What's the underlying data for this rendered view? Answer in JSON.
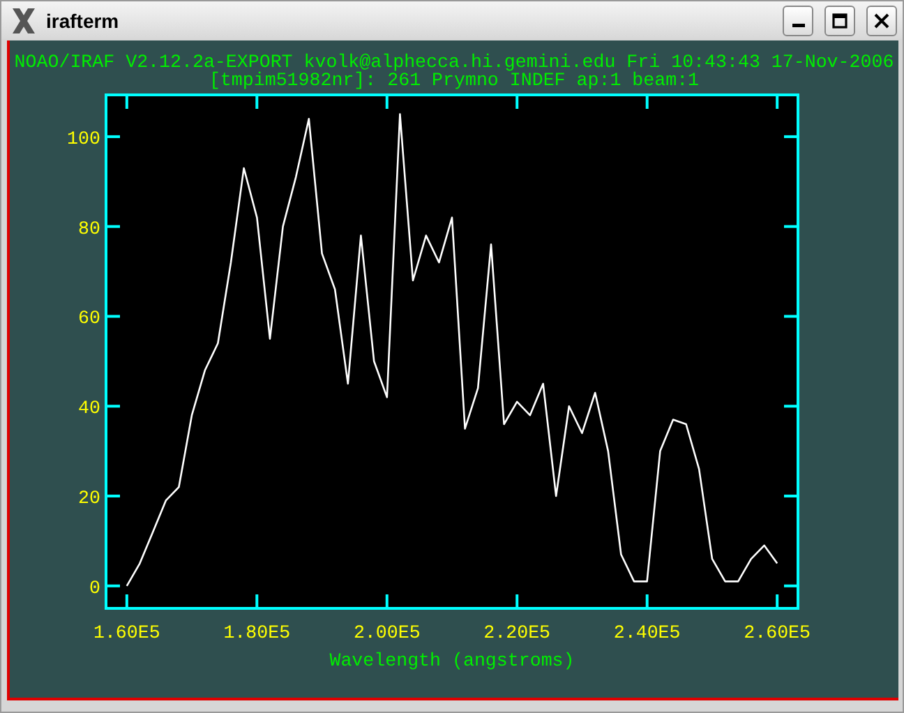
{
  "window": {
    "title": "irafterm"
  },
  "header": "NOAO/IRAF V2.12.2a-EXPORT kvolk@alphecca.hi.gemini.edu Fri 10:43:43 17-Nov-2006",
  "chart_data": {
    "type": "line",
    "title": "[tmpim51982nr]: 261 Prymno INDEF ap:1 beam:1",
    "xlabel": "Wavelength (angstroms)",
    "x": [
      160000,
      162000,
      164000,
      166000,
      168000,
      170000,
      172000,
      174000,
      176000,
      178000,
      180000,
      182000,
      184000,
      186000,
      188000,
      190000,
      192000,
      194000,
      196000,
      198000,
      200000,
      202000,
      204000,
      206000,
      208000,
      210000,
      212000,
      214000,
      216000,
      218000,
      220000,
      222000,
      224000,
      226000,
      228000,
      230000,
      232000,
      234000,
      236000,
      238000,
      240000,
      242000,
      244000,
      246000,
      248000,
      250000,
      252000,
      254000,
      256000,
      258000,
      260000
    ],
    "series": [
      {
        "color": "#ffffff",
        "values": [
          0,
          5,
          12,
          19,
          22,
          38,
          48,
          54,
          72,
          93,
          82,
          55,
          80,
          91,
          104,
          74,
          66,
          45,
          78,
          50,
          42,
          105,
          68,
          78,
          72,
          82,
          35,
          44,
          76,
          36,
          41,
          38,
          45,
          20,
          40,
          34,
          43,
          30,
          7,
          1,
          1,
          30,
          37,
          36,
          26,
          6,
          1,
          1,
          6,
          9,
          5
        ]
      }
    ],
    "xlim": [
      156800,
      263200
    ],
    "ylim": [
      -5,
      109.3
    ],
    "xticks": [
      {
        "value": 160000,
        "label": "1.60E5"
      },
      {
        "value": 180000,
        "label": "1.80E5"
      },
      {
        "value": 200000,
        "label": "2.00E5"
      },
      {
        "value": 220000,
        "label": "2.20E5"
      },
      {
        "value": 240000,
        "label": "2.40E5"
      },
      {
        "value": 260000,
        "label": "2.60E5"
      }
    ],
    "yticks": [
      0,
      20,
      40,
      60,
      80,
      100
    ]
  }
}
